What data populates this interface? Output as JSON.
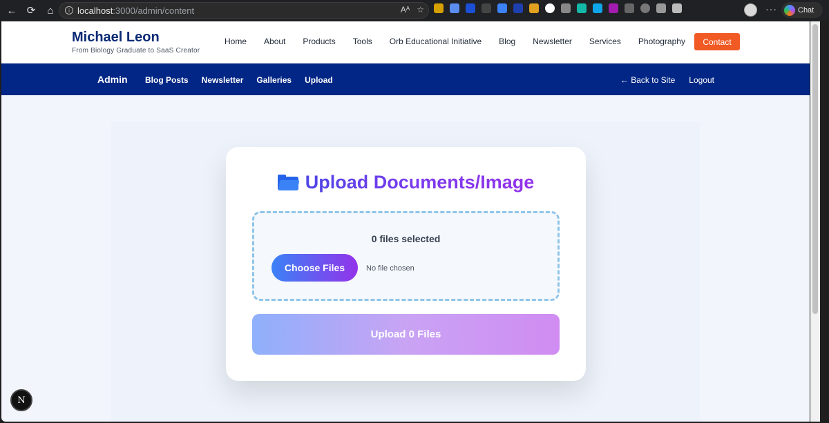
{
  "browser": {
    "url_host": "localhost",
    "url_path": ":3000/admin/content",
    "chat_label": "Chat"
  },
  "site": {
    "brand_name": "Michael Leon",
    "brand_tagline": "From Biology Graduate to SaaS Creator",
    "nav": [
      "Home",
      "About",
      "Products",
      "Tools",
      "Orb Educational Initiative",
      "Blog",
      "Newsletter",
      "Services",
      "Photography"
    ],
    "contact_label": "Contact"
  },
  "admin": {
    "title": "Admin",
    "nav": [
      "Blog Posts",
      "Newsletter",
      "Galleries",
      "Upload"
    ],
    "back_label": "← Back to Site",
    "logout_label": "Logout"
  },
  "upload": {
    "title": "Upload Documents/Image",
    "files_selected": "0 files selected",
    "choose_label": "Choose Files",
    "no_file_label": "No file chosen",
    "upload_label": "Upload 0 Files"
  },
  "colors": {
    "admin_bar": "#022685",
    "contact": "#f15a24",
    "brand": "#0b2a75"
  },
  "next_badge": "N"
}
